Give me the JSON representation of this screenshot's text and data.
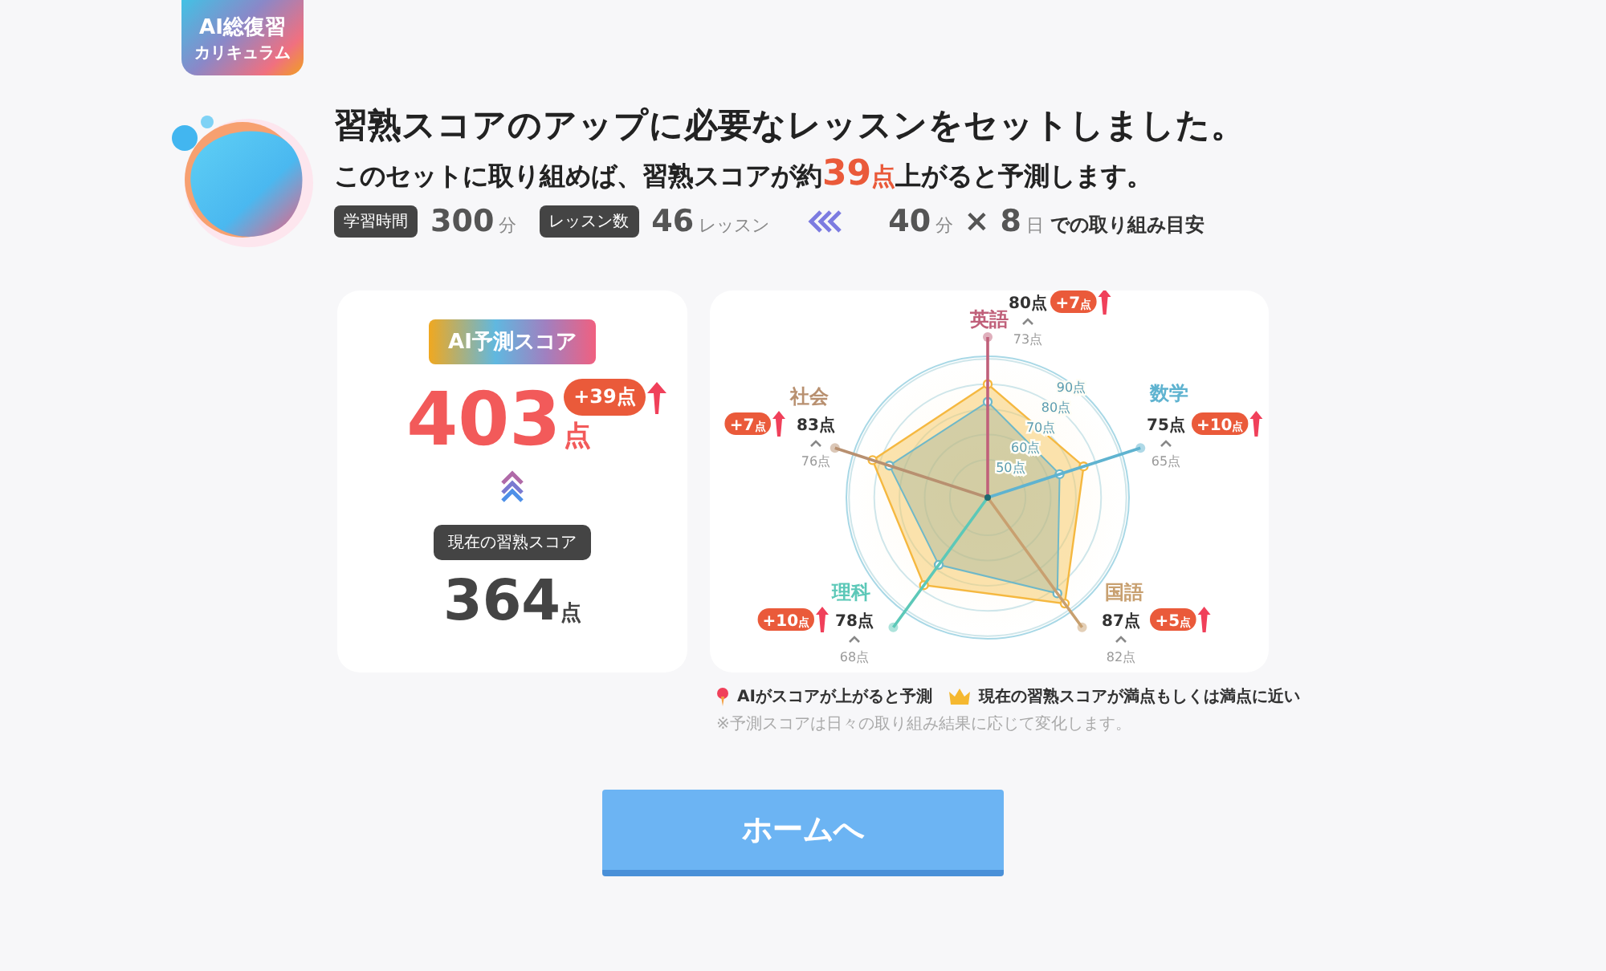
{
  "logo": {
    "line1": "AI総復習",
    "line2": "カリキュラム"
  },
  "headline": "習熟スコアのアップに必要なレッスンをセットしました。",
  "subline": {
    "before": "このセットに取り組めば、習熟スコアが約",
    "value": "39",
    "unit": "点",
    "after": "上がると予測します。"
  },
  "stats": [
    {
      "label": "学習時間",
      "value": "300",
      "unit": "分"
    },
    {
      "label": "レッスン数",
      "value": "46",
      "unit": "レッスン"
    }
  ],
  "schedule": {
    "minutes": "40",
    "minutes_unit": "分",
    "times": "×",
    "days": "8",
    "days_unit": "日",
    "suffix": "での取り組み目安"
  },
  "predicted": {
    "tag": "AI予測スコア",
    "value": "403",
    "unit": "点",
    "gain": "+39点"
  },
  "current": {
    "tag": "現在の習熟スコア",
    "value": "364",
    "unit": "点"
  },
  "radar": {
    "rings": [
      "50点",
      "60点",
      "70点",
      "80点",
      "90点"
    ],
    "subjects": [
      {
        "name": "英語",
        "color": "#c0607a",
        "predicted": "80点",
        "current": "73点",
        "gain": "+7",
        "gain_unit": "点"
      },
      {
        "name": "社会",
        "color": "#b89070",
        "predicted": "83点",
        "current": "76点",
        "gain": "+7",
        "gain_unit": "点"
      },
      {
        "name": "数学",
        "color": "#5fb3d0",
        "predicted": "75点",
        "current": "65点",
        "gain": "+10",
        "gain_unit": "点"
      },
      {
        "name": "理科",
        "color": "#5cc8b8",
        "predicted": "78点",
        "current": "68点",
        "gain": "+10",
        "gain_unit": "点"
      },
      {
        "name": "国語",
        "color": "#c8a070",
        "predicted": "87点",
        "current": "82点",
        "gain": "+5",
        "gain_unit": "点"
      }
    ]
  },
  "legend": [
    {
      "kind": "pin",
      "text": "AIがスコアが上がると予測"
    },
    {
      "kind": "crown",
      "text": "現在の習熟スコアが満点もしくは満点に近い"
    }
  ],
  "note": "※予測スコアは日々の取り組み結果に応じて変化します。",
  "button": "ホームへ"
}
